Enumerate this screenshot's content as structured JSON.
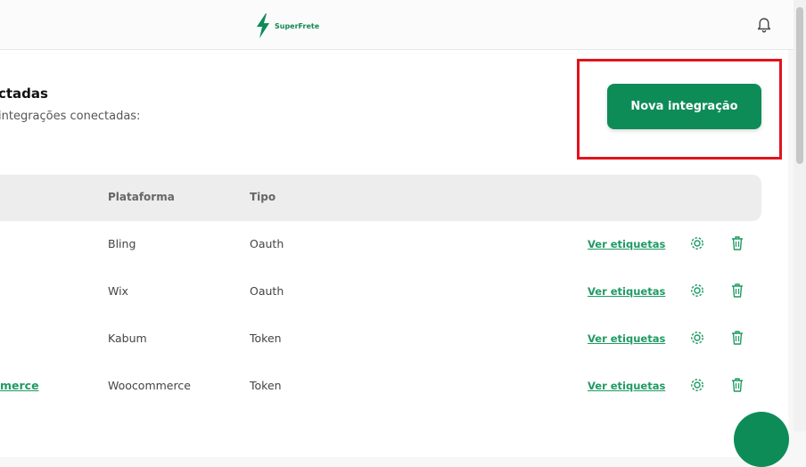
{
  "header": {
    "logo_text": "SuperFrete",
    "brand_color": "#0e8c57"
  },
  "page": {
    "title": "ctadas",
    "subtitle": "integrações conectadas:",
    "new_button_label": "Nova integração"
  },
  "table": {
    "columns": [
      "Plataforma",
      "Tipo"
    ],
    "rows": [
      {
        "name": "",
        "platform": "Bling",
        "type": "Oauth",
        "action_label": "Ver etiquetas"
      },
      {
        "name": "",
        "platform": "Wix",
        "type": "Oauth",
        "action_label": "Ver etiquetas"
      },
      {
        "name": "",
        "platform": "Kabum",
        "type": "Token",
        "action_label": "Ver etiquetas"
      },
      {
        "name": "merce",
        "platform": "Woocommerce",
        "type": "Token",
        "action_label": "Ver etiquetas"
      }
    ]
  }
}
